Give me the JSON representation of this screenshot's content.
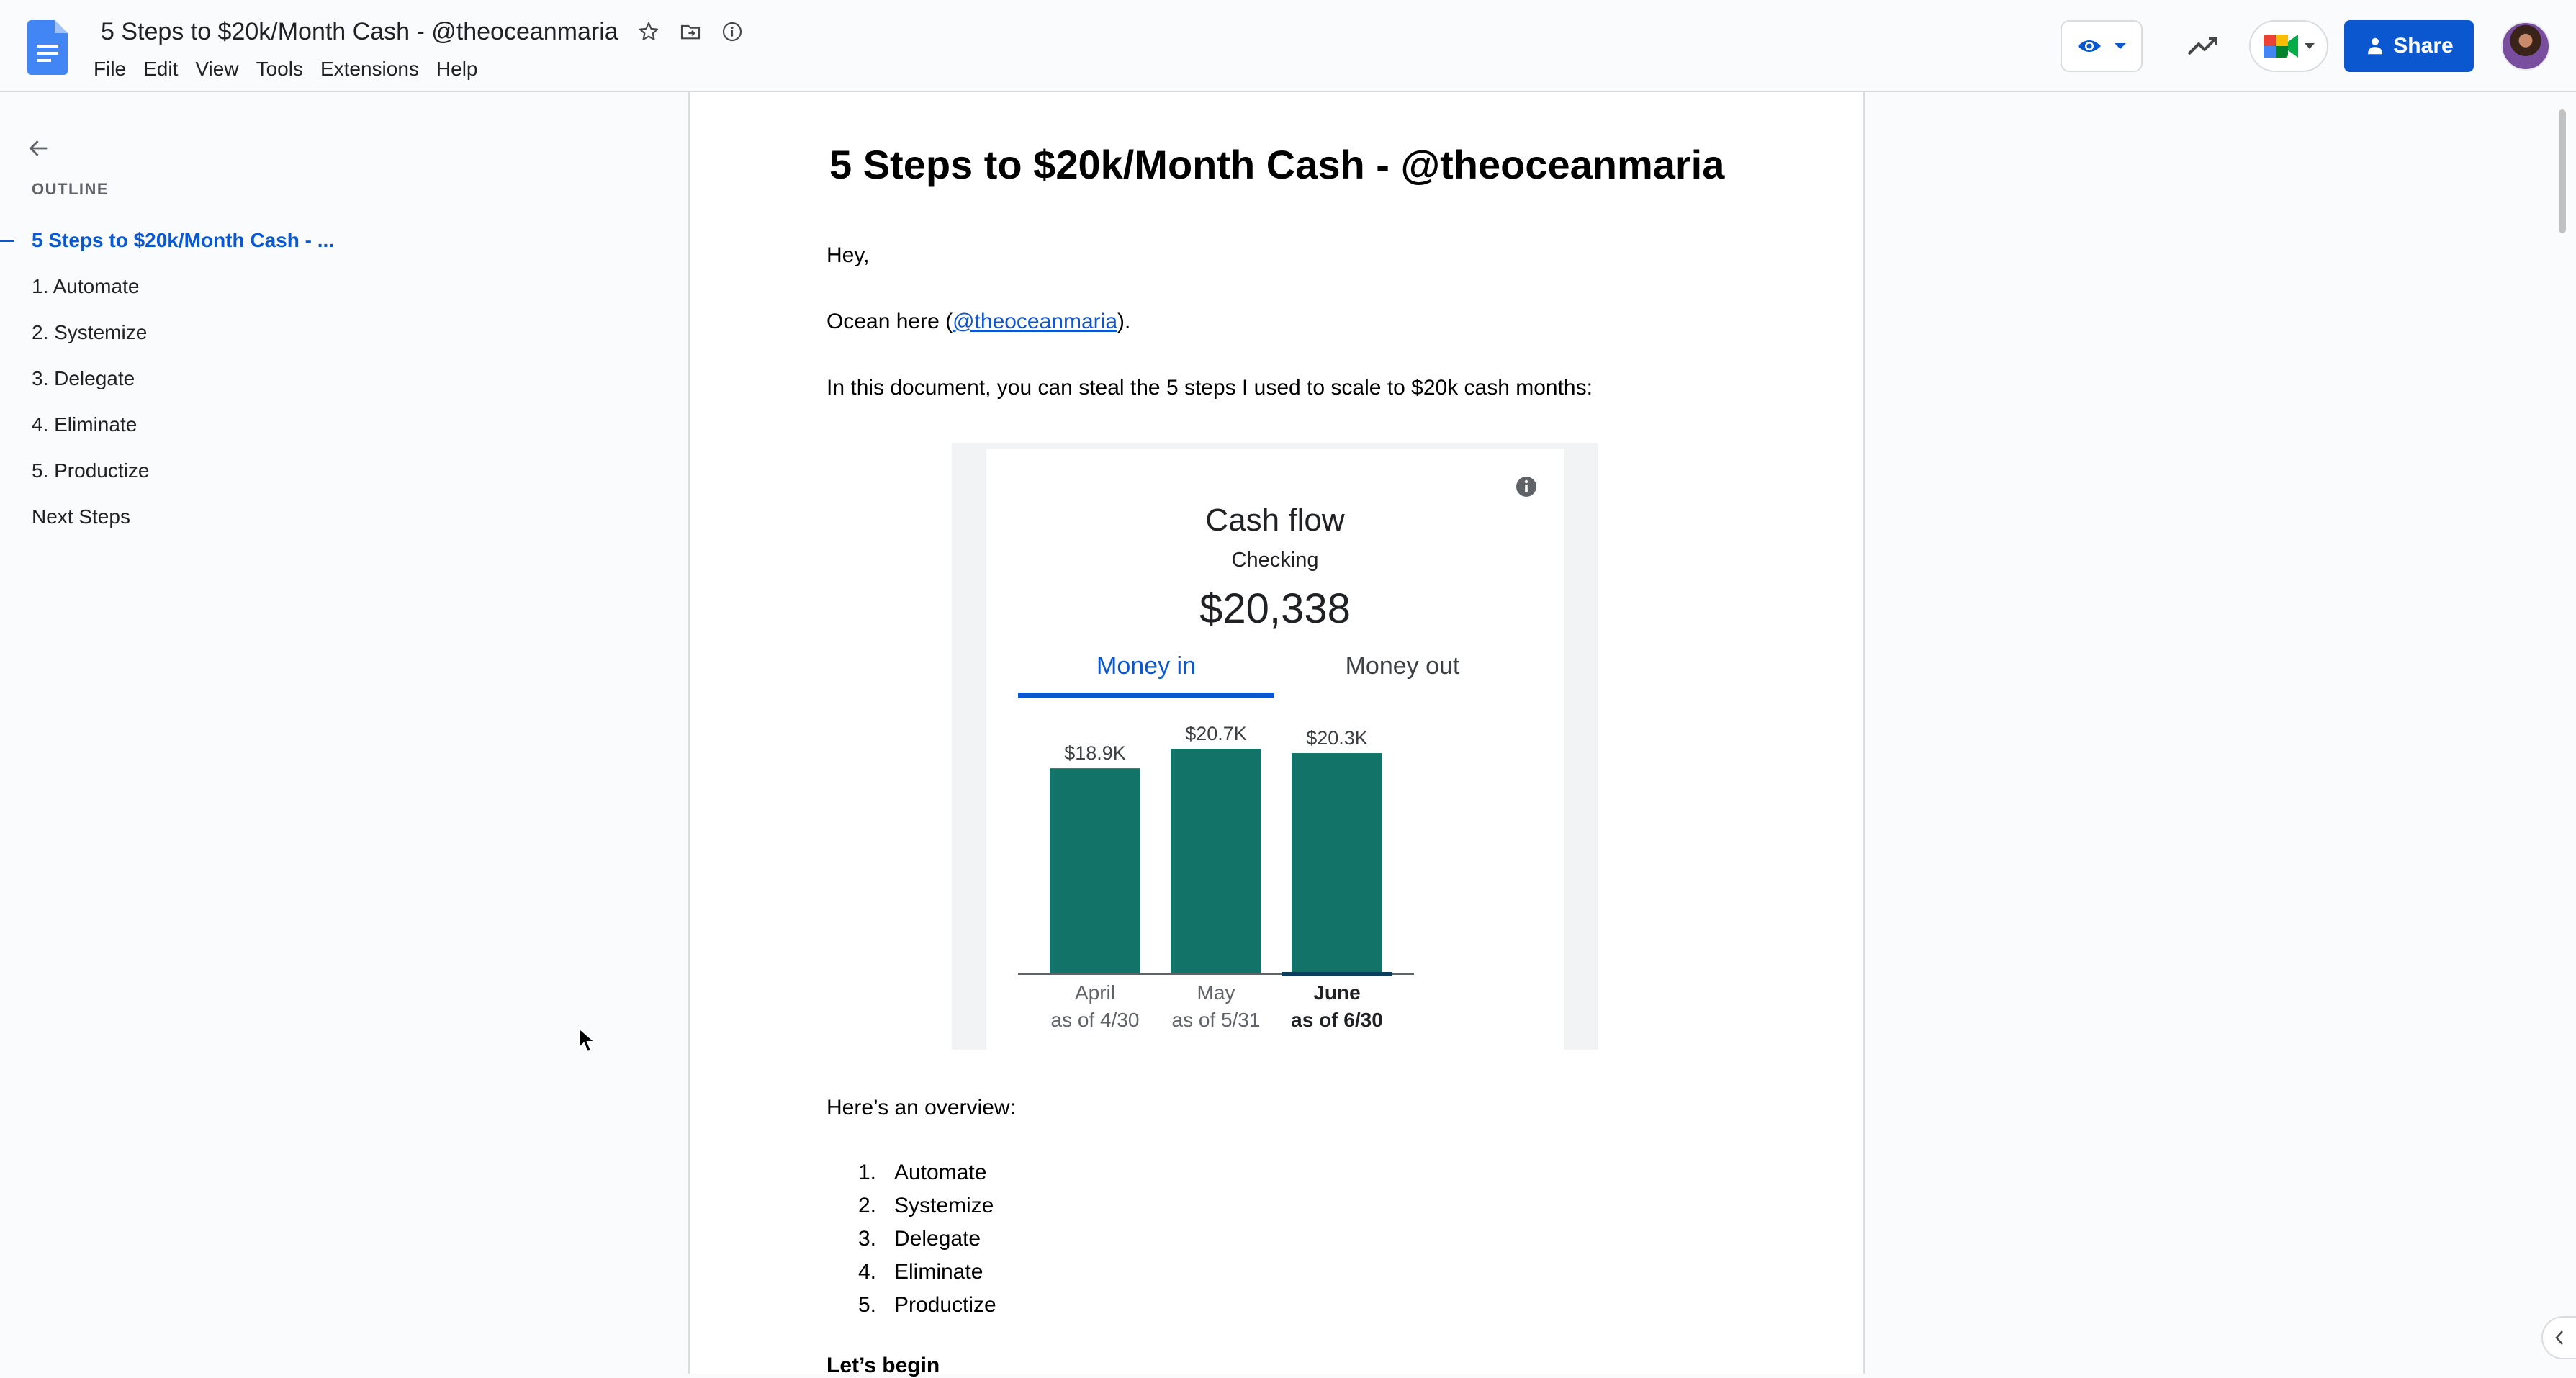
{
  "window": {
    "doc_title": "5 Steps to $20k/Month Cash - @theoceanmaria",
    "menu": [
      "File",
      "Edit",
      "View",
      "Tools",
      "Extensions",
      "Help"
    ],
    "share_label": "Share",
    "icons": {
      "logo": "google-docs-icon",
      "star": "star-icon",
      "move": "folder-move-icon",
      "info": "info-icon",
      "mode": "eye-icon",
      "trend": "trend-icon",
      "meet": "video-call-icon"
    }
  },
  "outline": {
    "label": "OUTLINE",
    "items": [
      "5 Steps to $20k/Month Cash - ...",
      "1. Automate",
      "2. Systemize",
      "3. Delegate",
      "4. Eliminate",
      "5. Productize",
      "Next Steps"
    ],
    "active_index": 0
  },
  "document": {
    "heading": "5 Steps to $20k/Month Cash - @theoceanmaria",
    "greeting": "Hey,",
    "intro_prefix": "Ocean here (",
    "intro_link": "@theoceanmaria",
    "intro_suffix": ").",
    "lead": "In this document, you can steal the 5 steps I used to scale to $20k cash months:",
    "overview_label": "Here’s an overview:",
    "overview": [
      {
        "num": "1.",
        "text": "Automate"
      },
      {
        "num": "2.",
        "text": "Systemize"
      },
      {
        "num": "3.",
        "text": "Delegate"
      },
      {
        "num": "4.",
        "text": "Eliminate"
      },
      {
        "num": "5.",
        "text": "Productize"
      }
    ],
    "lets_begin": "Let’s begin"
  },
  "cashflow": {
    "title": "Cash flow",
    "account": "Checking",
    "amount": "$20,338",
    "tabs": [
      "Money in",
      "Money out"
    ],
    "active_tab": 0
  },
  "chart_data": {
    "type": "bar",
    "title": "Cash flow",
    "categories": [
      "April",
      "May",
      "June"
    ],
    "sublabels": [
      "as of 4/30",
      "as of 5/31",
      "as of 6/30"
    ],
    "values": [
      18.9,
      20.7,
      20.3
    ],
    "value_labels": [
      "$18.9K",
      "$20.7K",
      "$20.3K"
    ],
    "ylim": [
      0,
      20.7
    ],
    "highlight_index": 2,
    "bar_color": "#127468",
    "grid": false
  },
  "colors": {
    "accent": "#0b57d0",
    "bar": "#127468"
  }
}
